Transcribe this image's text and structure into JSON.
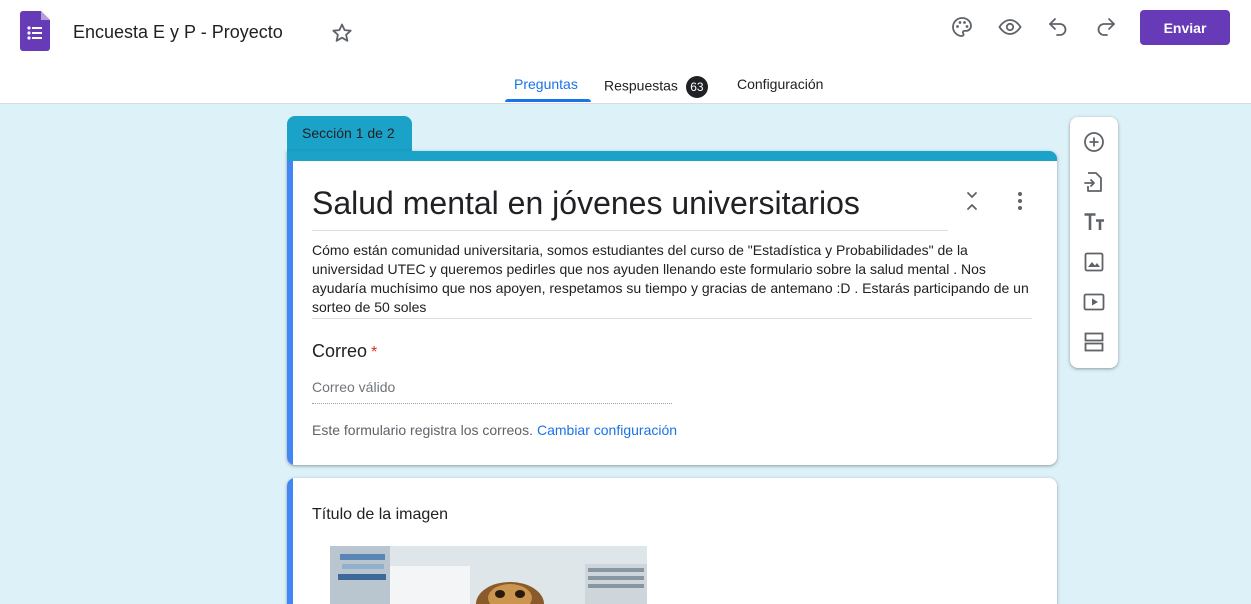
{
  "header": {
    "doc_title": "Encuesta E y P - Proyecto",
    "send_label": "Enviar",
    "icons": [
      "forms-logo-icon",
      "star-icon",
      "palette-icon",
      "eye-preview-icon",
      "undo-icon",
      "redo-icon"
    ],
    "accent_color": "#673ab7"
  },
  "tabs": {
    "questions": "Preguntas",
    "responses": "Respuestas",
    "responses_count": "63",
    "settings": "Configuración"
  },
  "section": {
    "label": "Sección 1 de 2",
    "color": "#1ba2c9"
  },
  "form": {
    "title": "Salud mental en jóvenes universitarios",
    "description": "Cómo están comunidad universitaria, somos estudiantes del curso de \"Estadística y Probabilidades\" de la universidad UTEC y queremos pedirles que nos ayuden llenando este formulario sobre la salud mental . Nos ayudaría muchísimo que nos apoyen, respetamos su tiempo y gracias de antemano :D . Estarás participando de un sorteo de 50 soles",
    "email_question": {
      "label": "Correo",
      "required_mark": "*",
      "placeholder": "Correo válido"
    },
    "email_note": "Este formulario registra los correos.",
    "email_note_link": "Cambiar configuración"
  },
  "image_item": {
    "title": "Título de la imagen"
  },
  "toolbar": {
    "icons": [
      "add-question-icon",
      "import-questions-icon",
      "add-title-icon",
      "add-image-icon",
      "add-video-icon",
      "add-section-icon"
    ]
  }
}
